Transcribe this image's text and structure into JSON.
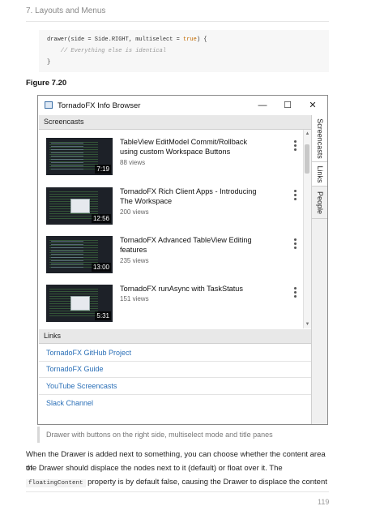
{
  "header": {
    "chapter": "7. Layouts and Menus"
  },
  "code": {
    "line1_pre": "drawer(side = Side.RIGHT, multiselect = ",
    "line1_kw": "true",
    "line1_post": ") {",
    "line2": "    // Everything else is identical",
    "line3": "}"
  },
  "figure_label": "Figure 7.20",
  "window": {
    "title": "TornadoFX Info Browser",
    "controls": {
      "minimize": "—",
      "maximize": "☐",
      "close": "✕"
    },
    "screencasts_header": "Screencasts",
    "links_header": "Links",
    "videos": [
      {
        "title": "TableView EditModel Commit/Rollback using custom Workspace Buttons",
        "views": "88 views",
        "duration": "7:19"
      },
      {
        "title": "TornadoFX Rich Client Apps - Introducing The Workspace",
        "views": "200 views",
        "duration": "12:56"
      },
      {
        "title": "TornadoFX Advanced TableView Editing features",
        "views": "235 views",
        "duration": "13:00"
      },
      {
        "title": "TornadoFX runAsync with TaskStatus",
        "views": "151 views",
        "duration": "5:31"
      }
    ],
    "links": [
      "TornadoFX GitHub Project",
      "TornadoFX Guide",
      "YouTube Screencasts",
      "Slack Channel"
    ],
    "drawer_tabs": [
      "Screencasts",
      "Links",
      "People"
    ]
  },
  "caption": "Drawer with buttons on the right side, multiselect mode and title panes",
  "paragraph": {
    "line1": "When the Drawer is added next to something, you can choose whether the content area of",
    "line2": "the Drawer should displace the nodes next to it (default) or float over it. The",
    "code": "floatingContent",
    "line3": " property is by default false, causing the Drawer to displace the content"
  },
  "page_number": "119"
}
